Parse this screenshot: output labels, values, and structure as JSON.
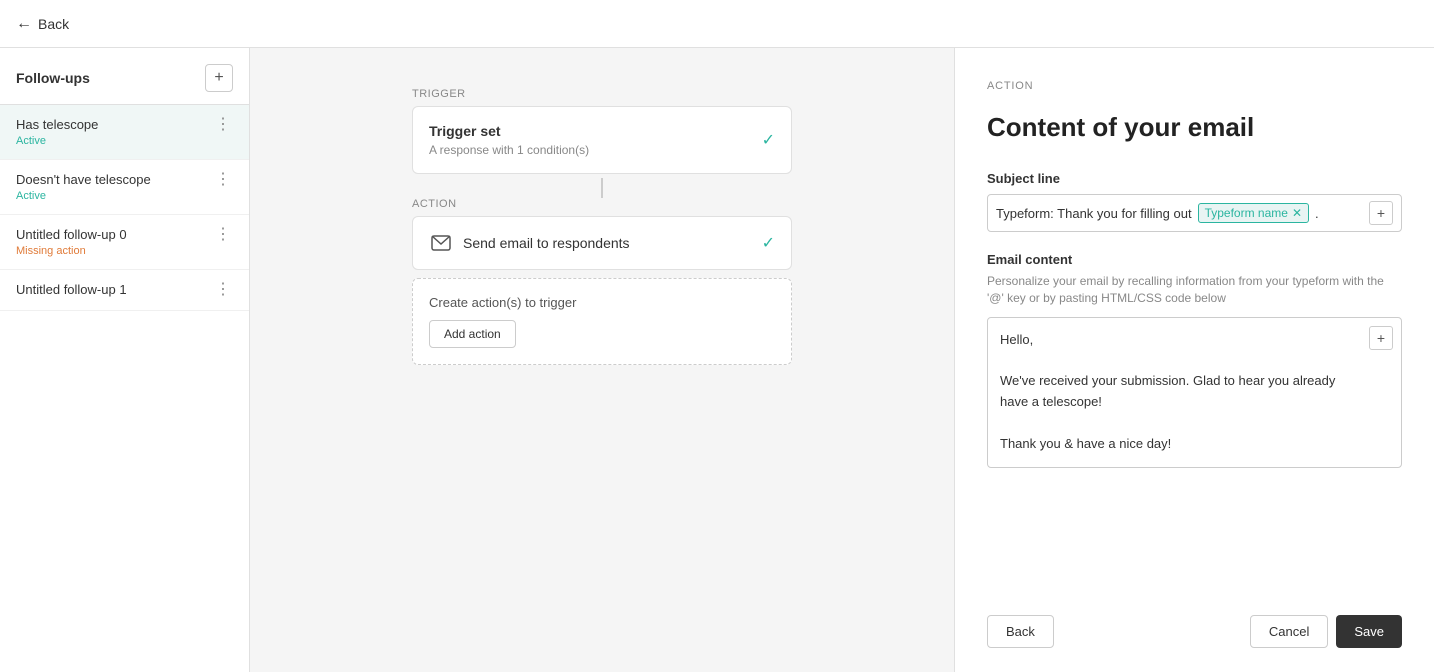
{
  "topbar": {
    "back_label": "Back"
  },
  "sidebar": {
    "title": "Follow-ups",
    "add_icon": "+",
    "items": [
      {
        "name": "Has telescope",
        "status": "Active",
        "status_type": "active",
        "active": true
      },
      {
        "name": "Doesn't have telescope",
        "status": "Active",
        "status_type": "active",
        "active": false
      },
      {
        "name": "Untitled follow-up 0",
        "status": "Missing action",
        "status_type": "missing",
        "active": false
      },
      {
        "name": "Untitled follow-up 1",
        "status": "",
        "status_type": "",
        "active": false
      }
    ]
  },
  "canvas": {
    "trigger_label": "Trigger",
    "action_label": "Action",
    "trigger_card": {
      "title": "Trigger set",
      "subtitle": "A response with 1 condition(s)"
    },
    "action_card": {
      "label": "Send email to respondents"
    },
    "create_actions": {
      "title": "Create action(s) to trigger",
      "add_action_label": "Add action"
    }
  },
  "right_panel": {
    "section_label": "ACTION",
    "title": "Content of your email",
    "subject_line": {
      "label": "Subject line",
      "prefix": "Typeform: Thank you for filling out",
      "tag": "Typeform name",
      "suffix": "."
    },
    "email_content": {
      "label": "Email content",
      "hint": "Personalize your email by recalling information from your typeform with the '@' key or by pasting HTML/CSS code below",
      "body_lines": [
        "Hello,",
        "",
        "We've received your submission. Glad to hear you already",
        "have a telescope!",
        "",
        "Thank you & have a nice day!"
      ]
    },
    "footer": {
      "back_label": "Back",
      "cancel_label": "Cancel",
      "save_label": "Save"
    }
  }
}
